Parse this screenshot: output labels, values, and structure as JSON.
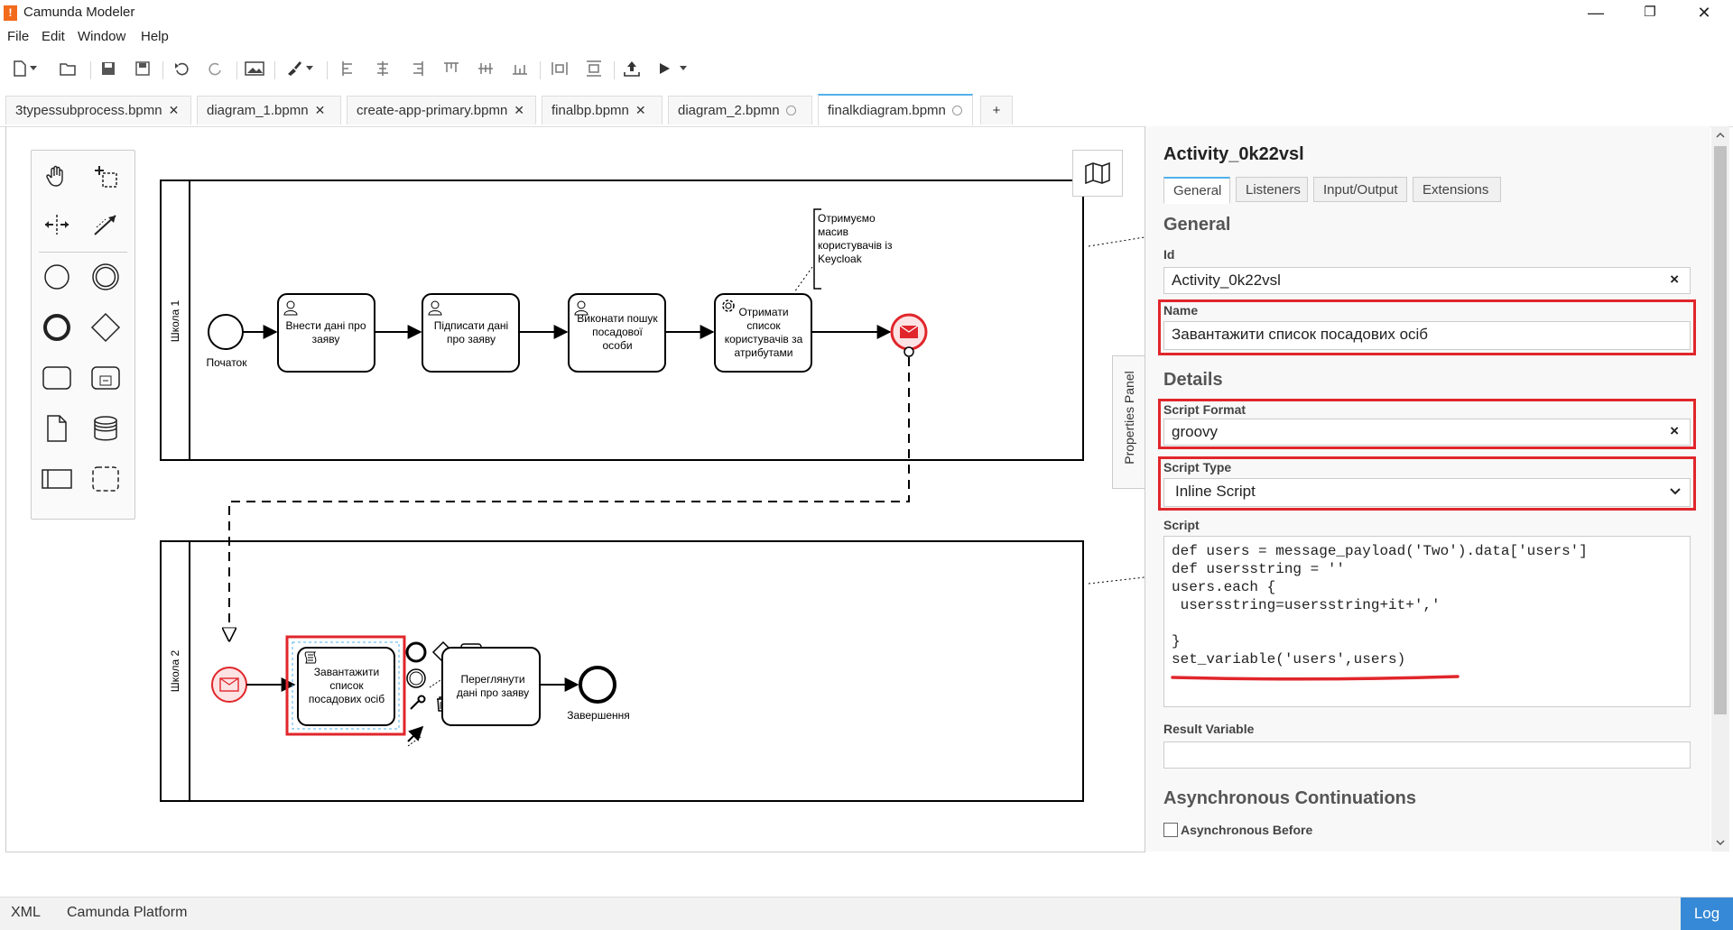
{
  "window": {
    "title": "Camunda Modeler",
    "minimize": "—",
    "maximize": "❐",
    "close": "✕"
  },
  "menu": [
    "File",
    "Edit",
    "Window",
    "Help"
  ],
  "tabs": [
    {
      "label": "3typessubprocess.bpmn",
      "state": "close"
    },
    {
      "label": "diagram_1.bpmn",
      "state": "close"
    },
    {
      "label": "create-app-primary.bpmn",
      "state": "close"
    },
    {
      "label": "finalbp.bpmn",
      "state": "close"
    },
    {
      "label": "diagram_2.bpmn",
      "state": "unsaved"
    },
    {
      "label": "finalkdiagram.bpmn",
      "state": "unsaved",
      "active": true
    }
  ],
  "tab_add": "+",
  "diagram": {
    "lane1": "Школа 1",
    "lane2": "Школа 2",
    "start_label": "Початок",
    "task1": [
      "Внести дані про",
      "заяву"
    ],
    "task2": [
      "Підписати дані",
      "про заяву"
    ],
    "task3": [
      "Виконати пошук",
      "посадової",
      "особи"
    ],
    "task4": [
      "Отримати",
      "список",
      "користувачів за",
      "атрибутами"
    ],
    "annotation": [
      "Отримуємо",
      "масив",
      "користувачів із",
      "Keycloak"
    ],
    "script_task": [
      "Завантажити",
      "список",
      "посадових осіб"
    ],
    "review_task": [
      "Переглянути",
      "дані про заяву"
    ],
    "end_label": "Завершення"
  },
  "properties_toggle": "Properties Panel",
  "panel": {
    "title": "Activity_0k22vsl",
    "tabs": [
      "General",
      "Listeners",
      "Input/Output",
      "Extensions"
    ],
    "group_general": "General",
    "id_label": "Id",
    "id_value": "Activity_0k22vsl",
    "name_label": "Name",
    "name_value": "Завантажити список посадових осіб",
    "group_details": "Details",
    "script_format_label": "Script Format",
    "script_format_value": "groovy",
    "script_type_label": "Script Type",
    "script_type_value": "Inline Script",
    "script_label": "Script",
    "script_value": "def users = message_payload('Two').data['users']\ndef usersstring = ''\nusers.each {\n usersstring=usersstring+it+','\n\n}\nset_variable('users',users)",
    "result_label": "Result Variable",
    "result_value": "",
    "group_async": "Asynchronous Continuations",
    "async_before": "Asynchronous Before",
    "clear": "×"
  },
  "status": {
    "xml": "XML",
    "platform": "Camunda Platform",
    "log": "Log"
  },
  "colors": {
    "accent": "#52b0ec",
    "highlight": "#e0262b",
    "log": "#3689d6"
  }
}
